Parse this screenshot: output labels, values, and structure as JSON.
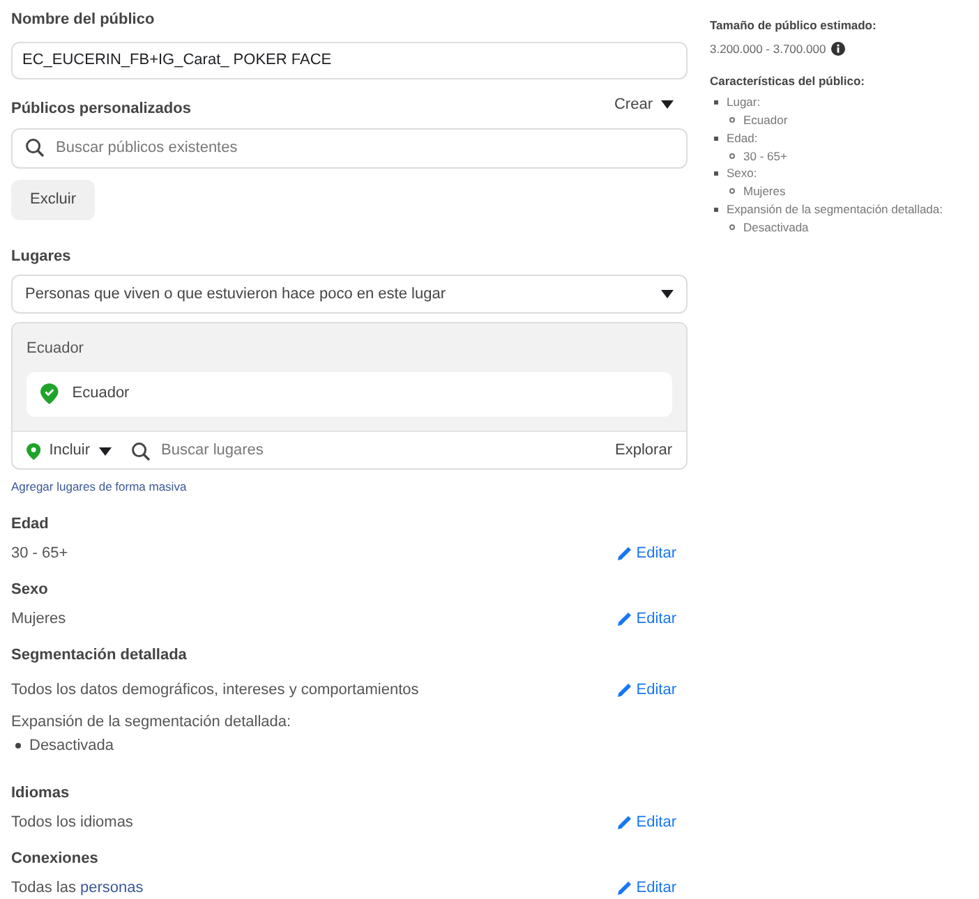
{
  "audience_name": {
    "label": "Nombre del público",
    "value": "EC_EUCERIN_FB+IG_Carat_ POKER FACE"
  },
  "custom_audiences": {
    "label": "Públicos personalizados",
    "create": "Crear",
    "placeholder": "Buscar públicos existentes",
    "exclude_button": "Excluir"
  },
  "locations": {
    "label": "Lugares",
    "type_select": "Personas que viven o que estuvieron hace poco en este lugar",
    "group_title": "Ecuador",
    "items": [
      {
        "name": "Ecuador"
      }
    ],
    "include": "Incluir",
    "placeholder": "Buscar lugares",
    "browse": "Explorar",
    "bulk_link": "Agregar lugares de forma masiva"
  },
  "sections": [
    {
      "title": "Edad",
      "value": "30 - 65+",
      "edit": "Editar"
    },
    {
      "title": "Sexo",
      "value": "Mujeres",
      "edit": "Editar"
    },
    {
      "title": "Segmentación detallada",
      "value": "Todos los datos demográficos, intereses y comportamientos",
      "edit": "Editar",
      "expansion_label": "Expansión de la segmentación detallada:",
      "expansion_items": [
        "Desactivada"
      ]
    },
    {
      "title": "Idiomas",
      "value": "Todos los idiomas",
      "edit": "Editar"
    },
    {
      "title": "Conexiones",
      "value": "Todas las",
      "link": "personas",
      "edit": "Editar"
    }
  ],
  "summary": {
    "size_title": "Tamaño de público estimado:",
    "size_value": "3.200.000 - 3.700.000",
    "characteristics_title": "Características del público:",
    "items": [
      {
        "label": "Lugar:",
        "children": [
          "Ecuador"
        ]
      },
      {
        "label": "Edad:",
        "children": [
          "30 - 65+"
        ]
      },
      {
        "label": "Sexo:",
        "children": [
          "Mujeres"
        ]
      },
      {
        "label": "Expansión de la segmentación detallada:",
        "children": [
          "Desactivada"
        ]
      }
    ]
  }
}
